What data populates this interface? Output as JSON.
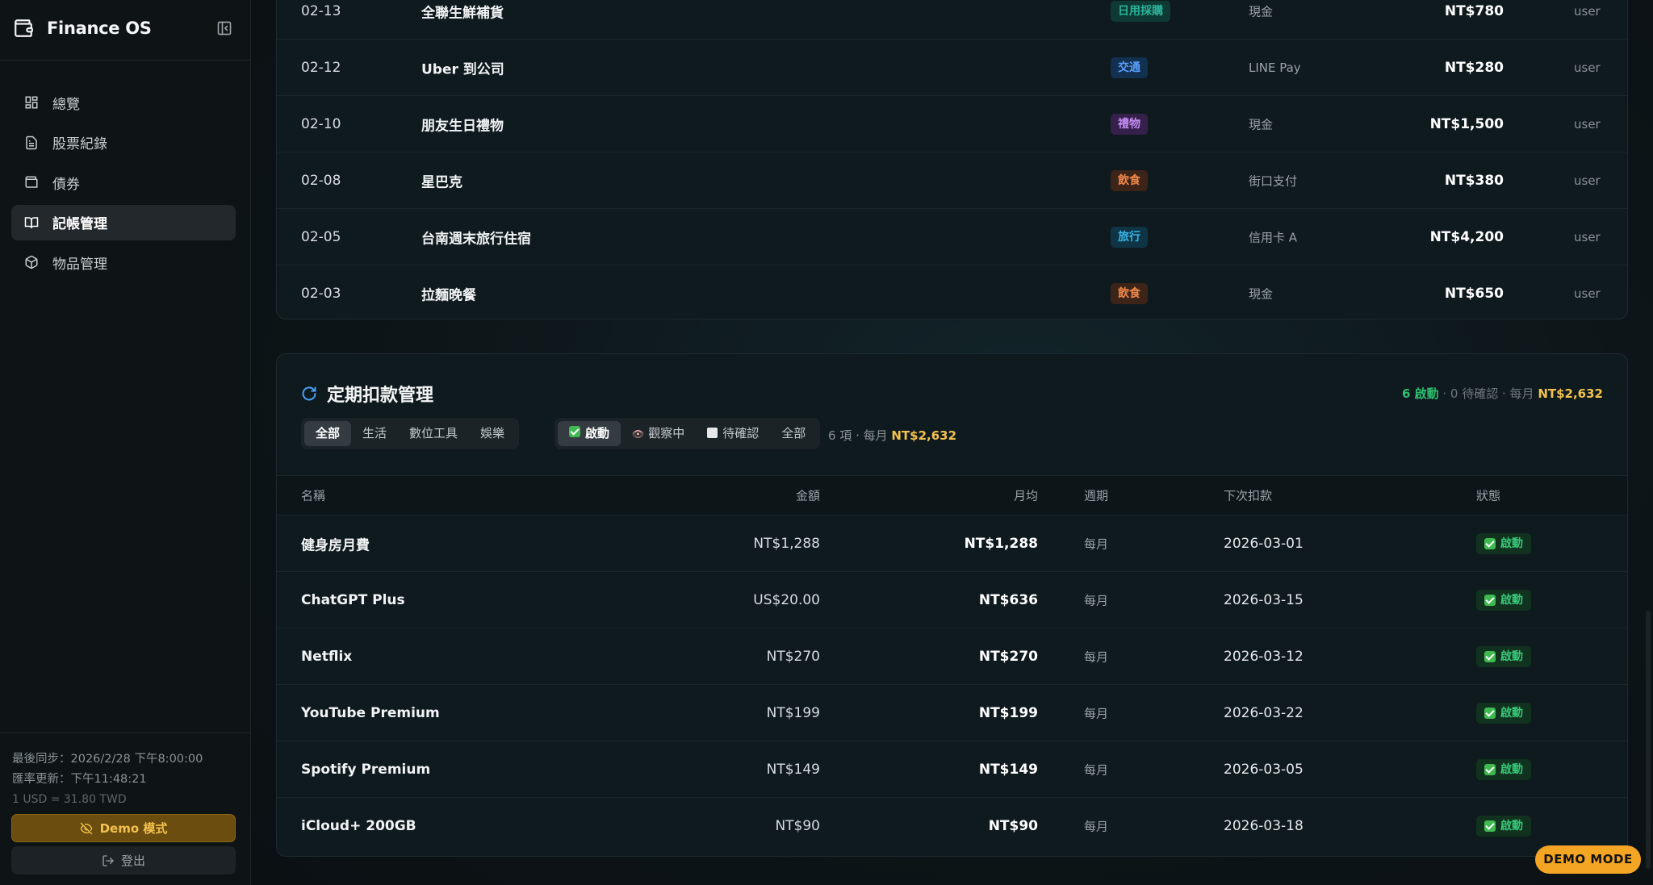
{
  "app": {
    "title": "Finance OS"
  },
  "sidebar": {
    "items": [
      {
        "label": "總覽",
        "icon": "dashboard-icon"
      },
      {
        "label": "股票紀錄",
        "icon": "document-icon"
      },
      {
        "label": "債券",
        "icon": "wallet-icon"
      },
      {
        "label": "記帳管理",
        "icon": "book-icon",
        "active": true
      },
      {
        "label": "物品管理",
        "icon": "box-icon"
      }
    ],
    "sync_last": "最後同步：2026/2/28 下午8:00:00",
    "rate_updated": "匯率更新：下午11:48:21",
    "rate_value": "1 USD = 31.80 TWD",
    "demo_button": "Demo 模式",
    "logout_button": "登出"
  },
  "transactions": [
    {
      "date": "02-13",
      "desc": "全聯生鮮補貨",
      "category": "日用採購",
      "cat_color": "#2bb39a",
      "cat_bg": "#0f3a33",
      "method": "現金",
      "amount": "NT$780",
      "user": "user"
    },
    {
      "date": "02-12",
      "desc": "Uber 到公司",
      "category": "交通",
      "cat_color": "#5aa0ff",
      "cat_bg": "#12304f",
      "method": "LINE Pay",
      "amount": "NT$280",
      "user": "user"
    },
    {
      "date": "02-10",
      "desc": "朋友生日禮物",
      "category": "禮物",
      "cat_color": "#c58cf2",
      "cat_bg": "#34204a",
      "method": "現金",
      "amount": "NT$1,500",
      "user": "user"
    },
    {
      "date": "02-08",
      "desc": "星巴克",
      "category": "飲食",
      "cat_color": "#f08a4b",
      "cat_bg": "#3d2418",
      "method": "街口支付",
      "amount": "NT$380",
      "user": "user"
    },
    {
      "date": "02-05",
      "desc": "台南週末旅行住宿",
      "category": "旅行",
      "cat_color": "#38b6e8",
      "cat_bg": "#0f3446",
      "method": "信用卡 A",
      "amount": "NT$4,200",
      "user": "user"
    },
    {
      "date": "02-03",
      "desc": "拉麵晚餐",
      "category": "飲食",
      "cat_color": "#f08a4b",
      "cat_bg": "#3d2418",
      "method": "現金",
      "amount": "NT$650",
      "user": "user"
    }
  ],
  "recurring": {
    "title": "定期扣款管理",
    "summary_active": "6 啟動",
    "summary_middle": " · 0 待確認 · 每月 ",
    "summary_total": "NT$2,632",
    "category_filters": [
      "全部",
      "生活",
      "數位工具",
      "娛樂"
    ],
    "status_filters": {
      "active": "啟動",
      "watching": "觀察中",
      "pending": "待確認",
      "all": "全部"
    },
    "filter_count": "6 項 · 每月 ",
    "filter_total": "NT$2,632",
    "columns": {
      "name": "名稱",
      "amount": "金額",
      "monthly": "月均",
      "cycle": "週期",
      "next": "下次扣款",
      "status": "狀態"
    },
    "rows": [
      {
        "name": "健身房月費",
        "amount": "NT$1,288",
        "monthly": "NT$1,288",
        "cycle": "每月",
        "next": "2026-03-01",
        "status": "啟動"
      },
      {
        "name": "ChatGPT Plus",
        "amount": "US$20.00",
        "monthly": "NT$636",
        "cycle": "每月",
        "next": "2026-03-15",
        "status": "啟動"
      },
      {
        "name": "Netflix",
        "amount": "NT$270",
        "monthly": "NT$270",
        "cycle": "每月",
        "next": "2026-03-12",
        "status": "啟動"
      },
      {
        "name": "YouTube Premium",
        "amount": "NT$199",
        "monthly": "NT$199",
        "cycle": "每月",
        "next": "2026-03-22",
        "status": "啟動"
      },
      {
        "name": "Spotify Premium",
        "amount": "NT$149",
        "monthly": "NT$149",
        "cycle": "每月",
        "next": "2026-03-05",
        "status": "啟動"
      },
      {
        "name": "iCloud+ 200GB",
        "amount": "NT$90",
        "monthly": "NT$90",
        "cycle": "每月",
        "next": "2026-03-18",
        "status": "啟動"
      }
    ]
  },
  "demo_badge": "DEMO MODE"
}
